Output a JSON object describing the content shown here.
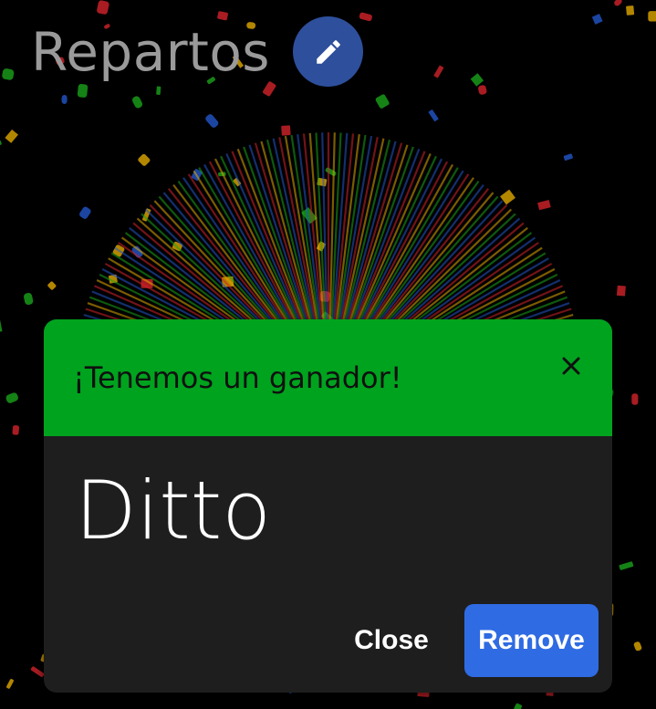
{
  "header": {
    "title": "Repartos",
    "edit_icon": "pencil-icon",
    "edit_button_color": "#2e4f9c"
  },
  "dialog": {
    "title": "¡Tenemos un ganador!",
    "header_color": "#00a31e",
    "close_icon": "close-icon",
    "winner": "Ditto",
    "close_label": "Close",
    "remove_label": "Remove",
    "remove_color": "#2f6be3"
  },
  "background": {
    "color": "#000000",
    "confetti_colors": [
      "#e0a800",
      "#1aa31a",
      "#2256c9",
      "#d2232a"
    ]
  }
}
